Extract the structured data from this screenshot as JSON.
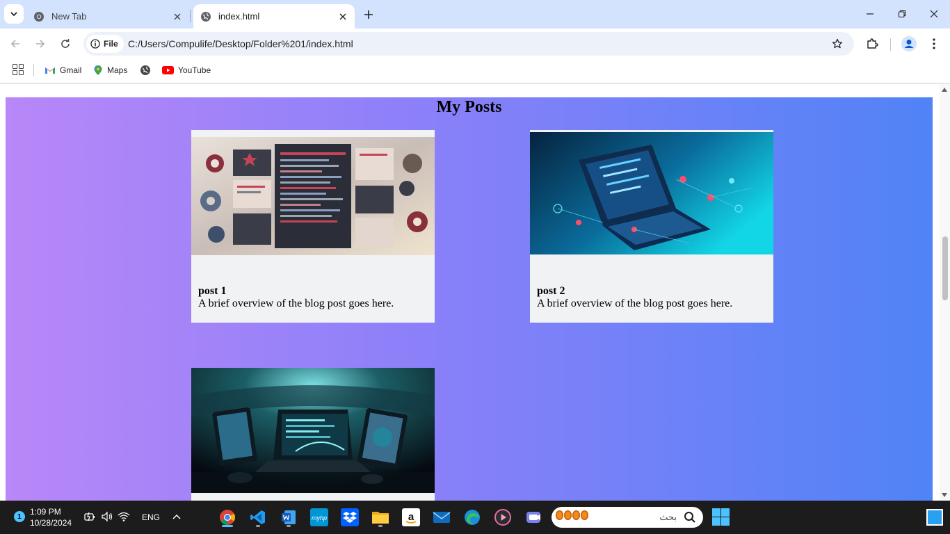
{
  "browser": {
    "tabs": [
      {
        "title": "New Tab",
        "active": false
      },
      {
        "title": "index.html",
        "active": true
      }
    ],
    "address_chip": "File",
    "url": "C:/Users/Compulife/Desktop/Folder%201/index.html",
    "bookmarks": [
      {
        "label": "Gmail",
        "icon": "gmail-icon"
      },
      {
        "label": "Maps",
        "icon": "maps-icon"
      },
      {
        "label": "",
        "icon": "globe-icon"
      },
      {
        "label": "YouTube",
        "icon": "youtube-icon"
      }
    ]
  },
  "page": {
    "heading": "My Posts",
    "gradient": [
      "#b887f8",
      "#8b80f9",
      "#5083f6"
    ],
    "posts": [
      {
        "title": "post 1",
        "description": "A brief overview of the blog post goes here.",
        "image": "coding-collage-image"
      },
      {
        "title": "post 2",
        "description": "A brief overview of the blog post goes here.",
        "image": "blue-laptop-image"
      },
      {
        "title": "",
        "description": "",
        "image": "dark-laptop-devices-image"
      }
    ]
  },
  "taskbar": {
    "notification_count": "1",
    "time": "1:09 PM",
    "date": "10/28/2024",
    "language": "ENG",
    "search_placeholder": "بحث",
    "apps": [
      "chrome-icon",
      "vscode-icon",
      "word-icon",
      "myhp-icon",
      "dropbox-icon",
      "file-explorer-icon",
      "amazon-icon",
      "mail-icon",
      "edge-icon",
      "media-player-icon",
      "teams-icon"
    ]
  },
  "colors": {
    "tab_strip": "#d3e3fd",
    "omnibox": "#edf2fa",
    "card": "#f1f2f4",
    "taskbar": "#1c1c1c",
    "accent": "#4cc2ff"
  }
}
